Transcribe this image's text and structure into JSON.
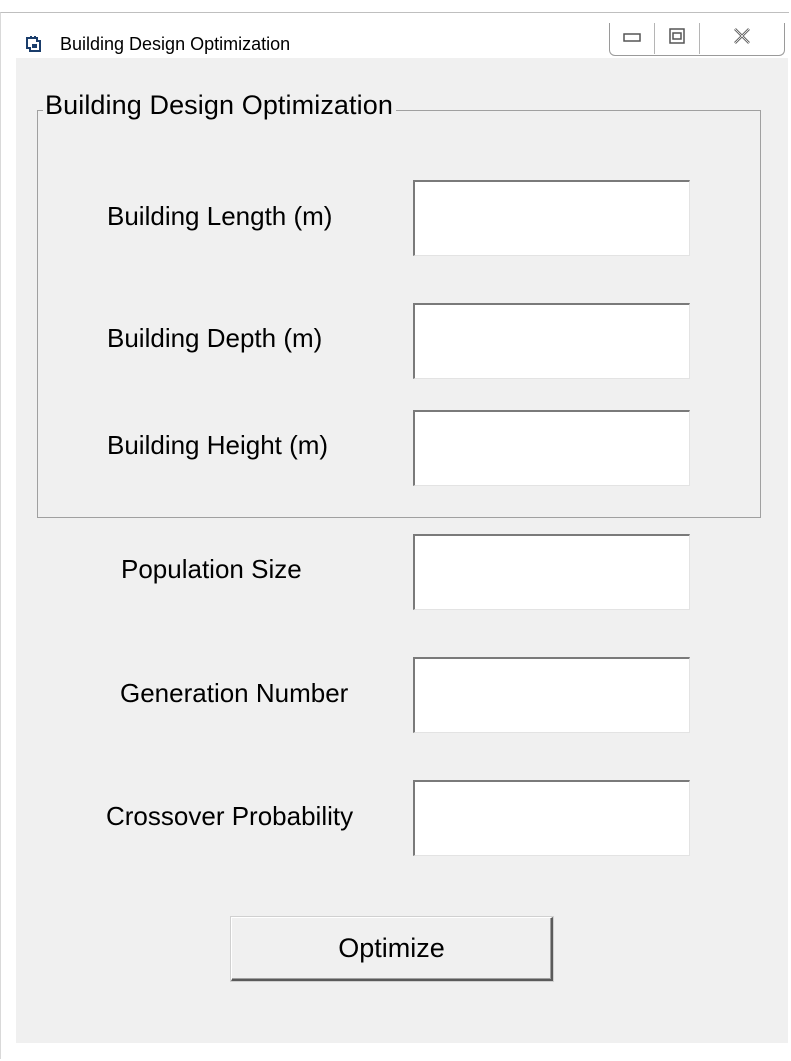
{
  "window": {
    "title": "Building Design Optimization",
    "icon": "app-window-icon",
    "caption_buttons": [
      "minimize-icon",
      "maximize-icon",
      "close-icon"
    ]
  },
  "group": {
    "title": "Building Design Optimization",
    "fields": [
      {
        "label": "Building Length (m)",
        "value": ""
      },
      {
        "label": "Building Depth (m)",
        "value": ""
      },
      {
        "label": "Building Height (m)",
        "value": ""
      }
    ]
  },
  "params": [
    {
      "label": "Population Size",
      "value": ""
    },
    {
      "label": "Generation Number",
      "value": ""
    },
    {
      "label": "Crossover Probability",
      "value": ""
    }
  ],
  "actions": {
    "optimize_label": "Optimize"
  }
}
